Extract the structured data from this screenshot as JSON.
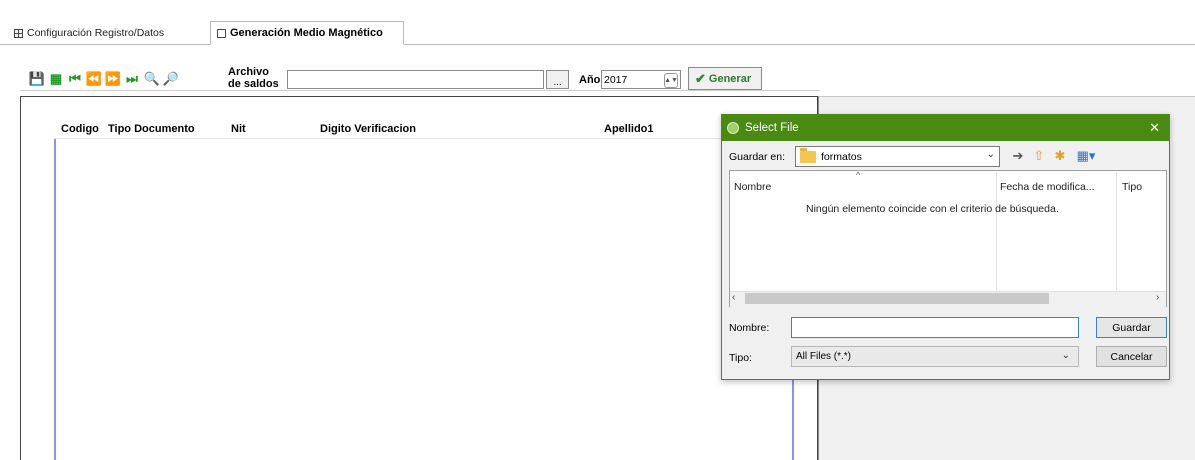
{
  "tabs": [
    {
      "label": "Configuración Registro/Datos"
    },
    {
      "label": "Generación Medio Magnético"
    }
  ],
  "toolbar": {
    "icons": [
      "save-icon",
      "export-icon",
      "first-record-icon",
      "previous-record-icon",
      "next-record-icon",
      "last-record-icon",
      "zoom-in-icon",
      "zoom-out-icon"
    ],
    "archivo_label_line1": "Archivo",
    "archivo_label_line2": "de saldos",
    "archivo_value": "",
    "browse_label": "...",
    "anio_label": "Año",
    "anio_value": "2017",
    "generar_label": "Generar"
  },
  "grid": {
    "columns": [
      "Codigo",
      "Tipo Documento",
      "Nit",
      "Digito Verificacion",
      "Apellido1"
    ],
    "rows": []
  },
  "dialog": {
    "title": "Select File",
    "close": "✕",
    "guardar_en_label": "Guardar en:",
    "folder": "formatos",
    "list_headers": [
      "Nombre",
      "Fecha de modifica...",
      "Tipo"
    ],
    "empty_message": "Ningún elemento coincide con el criterio de búsqueda.",
    "nombre_label": "Nombre:",
    "nombre_value": "",
    "tipo_label": "Tipo:",
    "tipo_value": "All Files (*.*)",
    "guardar_button": "Guardar",
    "cancelar_button": "Cancelar"
  },
  "colors": {
    "dialog_title_bg": "#4a8a12",
    "grid_accent": "#8b95e8",
    "toolbar_icon_green": "#1f9a1f"
  }
}
